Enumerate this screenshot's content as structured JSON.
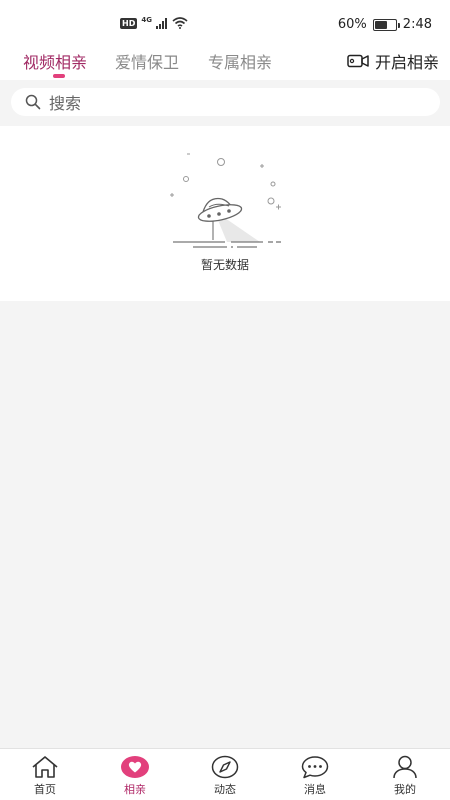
{
  "status_bar": {
    "hd": "HD",
    "network": "4G",
    "battery": "60%",
    "battery_level": 0.6,
    "time": "2:48"
  },
  "tabs": [
    {
      "label": "视频相亲",
      "active": true
    },
    {
      "label": "爱情保卫",
      "active": false
    },
    {
      "label": "专属相亲",
      "active": false
    }
  ],
  "open_button": {
    "label": "开启相亲",
    "icon": "video-camera-icon"
  },
  "search": {
    "placeholder": "搜索",
    "icon": "search-icon"
  },
  "empty_state": {
    "text": "暂无数据",
    "icon": "ufo-icon"
  },
  "bottom_nav": [
    {
      "label": "首页",
      "icon": "home-icon",
      "active": false
    },
    {
      "label": "相亲",
      "icon": "heart-icon",
      "active": true
    },
    {
      "label": "动态",
      "icon": "compass-icon",
      "active": false
    },
    {
      "label": "消息",
      "icon": "chat-icon",
      "active": false
    },
    {
      "label": "我的",
      "icon": "user-icon",
      "active": false
    }
  ],
  "colors": {
    "accent": "#e2407c",
    "active_text": "#a12a64",
    "background": "#f4f4f4"
  }
}
